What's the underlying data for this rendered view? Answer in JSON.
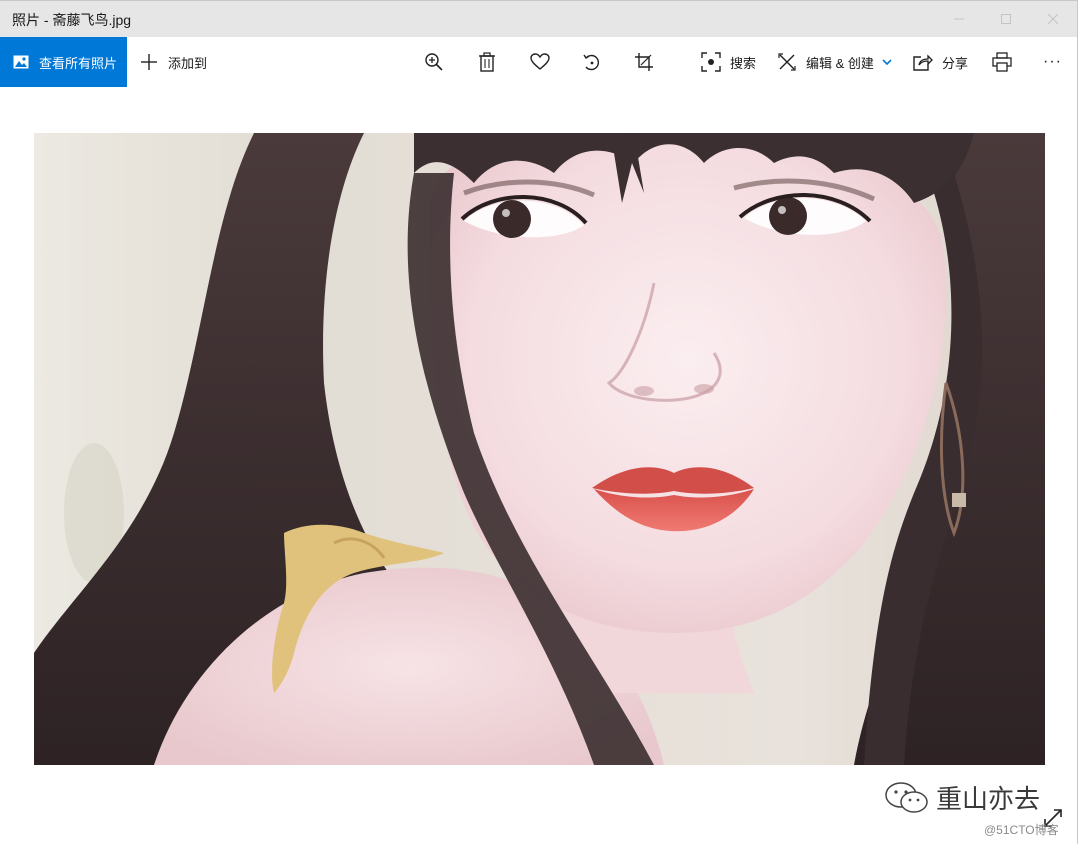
{
  "window": {
    "title": "照片 - 斋藤飞鸟.jpg",
    "controls": [
      "minimize-icon",
      "maximize-icon",
      "close-icon"
    ]
  },
  "toolbar": {
    "all_photos_label": "查看所有照片",
    "add_to_label": "添加到",
    "search_label": "搜索",
    "edit_create_label": "编辑 & 创建",
    "share_label": "分享",
    "more_label": "···",
    "icons": [
      "zoom-in-icon",
      "delete-icon",
      "heart-icon",
      "rotate-icon",
      "crop-icon",
      "search-icon",
      "edit-icon",
      "share-icon",
      "print-icon"
    ]
  },
  "watermark": {
    "text": "重山亦去",
    "site": "@51CTO博客"
  },
  "colors": {
    "accent": "#0078d7",
    "titlebar": "#e6e6e6",
    "lips": "#e0615a",
    "hair": "#3b2e2f",
    "skin": "#f6e1e3",
    "strap": "#e0c27d"
  }
}
